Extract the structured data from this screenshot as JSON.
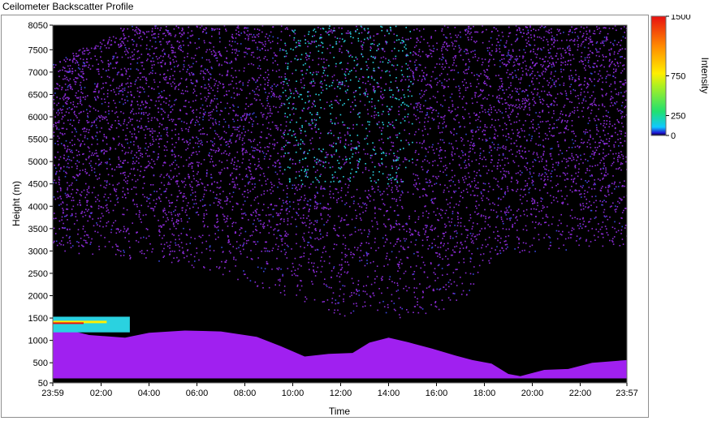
{
  "window": {
    "title": "Ceilometer Backscatter Profile"
  },
  "colors": {
    "background": "#000000",
    "noise": "#8c2bd8",
    "cloud_layer": "#a020f0",
    "high_low": "#2ad2e0",
    "mid": "#ffee00",
    "max": "#e81010"
  },
  "chart_data": {
    "type": "heatmap",
    "title": "",
    "xlabel": "Time",
    "ylabel": "Height (m)",
    "x_ticks": [
      "23:59",
      "02:00",
      "04:00",
      "06:00",
      "08:00",
      "10:00",
      "12:00",
      "14:00",
      "16:00",
      "18:00",
      "20:00",
      "22:00",
      "23:57"
    ],
    "x_ticks_hours": [
      -0.0167,
      2,
      4,
      6,
      8,
      10,
      12,
      14,
      16,
      18,
      20,
      22,
      23.95
    ],
    "xlim": [
      -0.0167,
      23.95
    ],
    "y_ticks": [
      50,
      500,
      1000,
      1500,
      2000,
      2500,
      3000,
      3500,
      4000,
      4500,
      5000,
      5500,
      6000,
      6500,
      7000,
      7500,
      8050
    ],
    "ylim": [
      50,
      8050
    ],
    "colorbar": {
      "label": "Intensity",
      "ticks": [
        0,
        250,
        750,
        1500
      ],
      "range": [
        0,
        1500
      ]
    },
    "cloud_top_profile": [
      {
        "t": -0.0167,
        "h": 1330
      },
      {
        "t": 0.5,
        "h": 1250
      },
      {
        "t": 1.5,
        "h": 1120
      },
      {
        "t": 3.0,
        "h": 1060
      },
      {
        "t": 4.0,
        "h": 1170
      },
      {
        "t": 5.5,
        "h": 1220
      },
      {
        "t": 7.0,
        "h": 1200
      },
      {
        "t": 8.5,
        "h": 1080
      },
      {
        "t": 9.5,
        "h": 870
      },
      {
        "t": 10.5,
        "h": 640
      },
      {
        "t": 11.5,
        "h": 700
      },
      {
        "t": 12.5,
        "h": 720
      },
      {
        "t": 13.2,
        "h": 950
      },
      {
        "t": 14.0,
        "h": 1060
      },
      {
        "t": 14.8,
        "h": 960
      },
      {
        "t": 15.8,
        "h": 820
      },
      {
        "t": 16.8,
        "h": 660
      },
      {
        "t": 17.5,
        "h": 560
      },
      {
        "t": 18.3,
        "h": 480
      },
      {
        "t": 19.0,
        "h": 250
      },
      {
        "t": 19.5,
        "h": 200
      },
      {
        "t": 20.5,
        "h": 340
      },
      {
        "t": 21.5,
        "h": 360
      },
      {
        "t": 22.5,
        "h": 500
      },
      {
        "t": 23.95,
        "h": 560
      }
    ],
    "strong_layer": {
      "t_start": -0.0167,
      "t_end": 3.2,
      "h_low": 1180,
      "h_high": 1530
    },
    "noise_top_profile": [
      {
        "t": -0.0167,
        "h": 7200
      },
      {
        "t": 3.0,
        "h": 8050
      },
      {
        "t": 17.0,
        "h": 8050
      },
      {
        "t": 23.95,
        "h": 8050
      }
    ],
    "noise_bottom_profile": [
      {
        "t": -0.0167,
        "h": 3000
      },
      {
        "t": 4.0,
        "h": 2800
      },
      {
        "t": 7.0,
        "h": 2500
      },
      {
        "t": 9.0,
        "h": 2100
      },
      {
        "t": 12.0,
        "h": 1500
      },
      {
        "t": 16.0,
        "h": 1500
      },
      {
        "t": 17.3,
        "h": 2000
      },
      {
        "t": 18.0,
        "h": 2700
      },
      {
        "t": 20.0,
        "h": 3000
      },
      {
        "t": 23.95,
        "h": 3100
      }
    ]
  }
}
